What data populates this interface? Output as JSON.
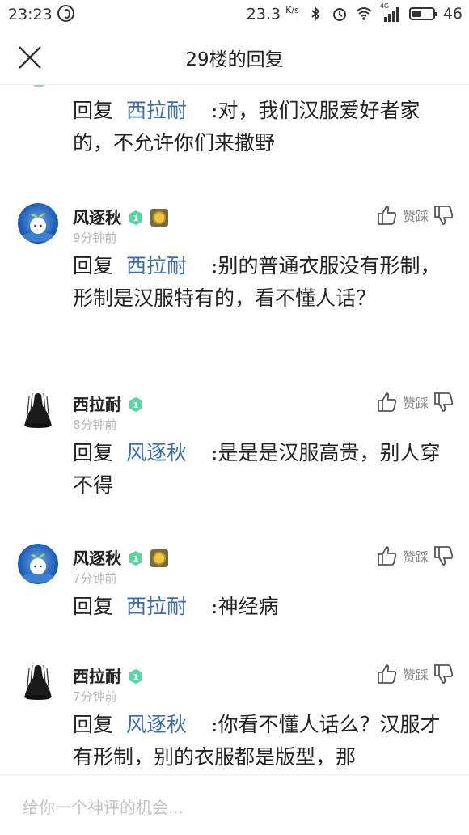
{
  "status_bar": {
    "time": "23:23",
    "speed": "23.3",
    "speed_unit": "K/s",
    "signal_type": "4G",
    "battery": "46",
    "battery_level": 0.46
  },
  "header": {
    "title": "29楼的回复"
  },
  "reply_label": "回复",
  "vote_label": "赞踩",
  "top_fragment": {
    "target": "西拉耐",
    "text": ":对，我们汉服爱好者家的，不允许你们来撒野"
  },
  "comments": [
    {
      "user": "风逐秋",
      "level": "1",
      "time": "9分钟前",
      "target": "西拉耐",
      "text": ":别的普通衣服没有形制，形制是汉服特有的，看不懂人话？"
    },
    {
      "user": "西拉耐",
      "level": "1",
      "time": "8分钟前",
      "target": "风逐秋",
      "text": ":是是是汉服高贵，别人穿不得"
    },
    {
      "user": "风逐秋",
      "level": "1",
      "time": "7分钟前",
      "target": "西拉耐",
      "text": ":神经病"
    },
    {
      "user": "西拉耐",
      "level": "1",
      "time": "7分钟前",
      "target": "风逐秋",
      "text": ":你看不懂人话么？汉服才有形制，别的衣服都是版型，那"
    }
  ],
  "input": {
    "placeholder": "给你一个神评的机会..."
  },
  "colors": {
    "link": "#3f6fa8",
    "level_badge": "#5ed3a4",
    "muted": "#b5b5b5"
  }
}
